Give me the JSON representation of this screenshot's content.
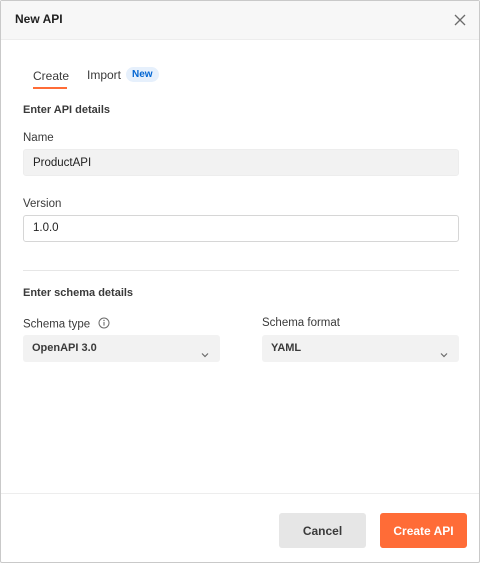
{
  "dialog": {
    "title": "New API",
    "close_icon": "close-icon"
  },
  "tabs": {
    "create": "Create",
    "import": "Import",
    "import_badge": "New",
    "active": "create"
  },
  "api_details": {
    "section_title": "Enter API details",
    "name_label": "Name",
    "name_value": "ProductAPI",
    "version_label": "Version",
    "version_value": "1.0.0"
  },
  "schema_details": {
    "section_title": "Enter schema details",
    "type_label": "Schema type",
    "type_info_icon": "info-icon",
    "type_value": "OpenAPI 3.0",
    "format_label": "Schema format",
    "format_value": "YAML"
  },
  "footer": {
    "cancel_label": "Cancel",
    "create_label": "Create API"
  },
  "colors": {
    "accent": "#ff6c37",
    "badge_text": "#0265d2",
    "badge_bg": "#e6f0fc"
  }
}
